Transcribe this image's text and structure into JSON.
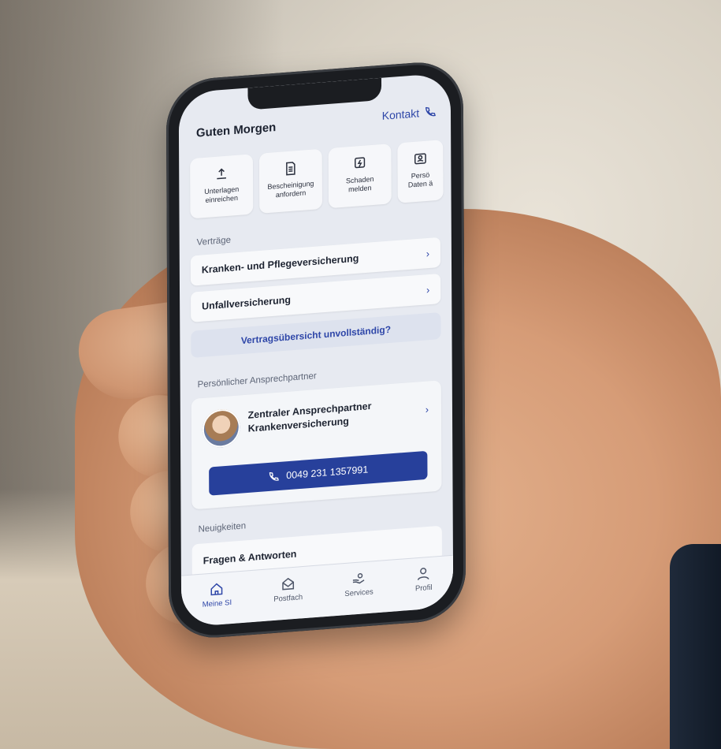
{
  "header": {
    "greeting": "Guten Morgen",
    "contact_label": "Kontakt"
  },
  "quick_actions": [
    {
      "icon": "upload-icon",
      "label": "Unterlagen\neinreichen"
    },
    {
      "icon": "document-icon",
      "label": "Bescheinigung\nanfordern"
    },
    {
      "icon": "damage-report-icon",
      "label": "Schaden\nmelden"
    },
    {
      "icon": "personal-data-icon",
      "label": "Persö\nDaten ä"
    }
  ],
  "contracts": {
    "section_title": "Verträge",
    "items": [
      {
        "label": "Kranken- und Pflegeversicherung"
      },
      {
        "label": "Unfallversicherung"
      }
    ],
    "incomplete_link": "Vertragsübersicht unvollständig?"
  },
  "contact_person": {
    "section_title": "Persönlicher Ansprechpartner",
    "title": "Zentraler Ansprechpartner Krankenversicherung",
    "phone": "0049 231 1357991"
  },
  "news": {
    "section_title": "Neuigkeiten",
    "first_item": "Fragen & Antworten"
  },
  "tabbar": [
    {
      "icon": "home-icon",
      "label": "Meine SI",
      "active": true
    },
    {
      "icon": "mail-icon",
      "label": "Postfach",
      "active": false
    },
    {
      "icon": "services-icon",
      "label": "Services",
      "active": false
    },
    {
      "icon": "profile-icon",
      "label": "Profil",
      "active": false
    }
  ],
  "colors": {
    "accent": "#2e46a8",
    "button": "#27409b",
    "screen_bg": "#e7eaf1"
  }
}
